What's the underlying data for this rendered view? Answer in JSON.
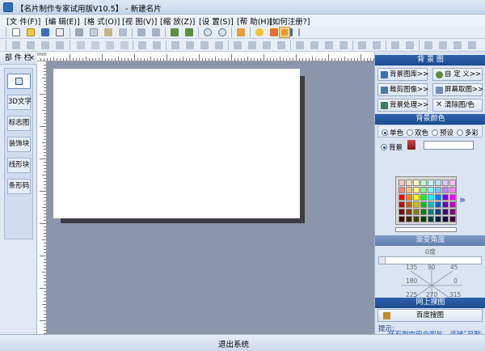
{
  "window": {
    "title": "【名片制作专家试用版V10.5】 - 新建名片"
  },
  "menu": [
    "[文 件(F)]",
    "[编 辑(E)]",
    "[格 式(O)]",
    "[视 图(V)]",
    "[缩 放(Z)]",
    "[设 置(S)]",
    "[帮 助(H)]",
    "[如何注册?]"
  ],
  "left_panel": {
    "header": "部 件 栏",
    "close": "×",
    "items": [
      "3D文字",
      "标志图",
      "装饰块",
      "线形块",
      "条形码"
    ]
  },
  "ruler": {
    "unit": "mm"
  },
  "right_panel": {
    "bg_header": "背 景 图",
    "bg_buttons": [
      "背景图库>>",
      "自 定 义>>",
      "裁剪图像>>",
      "屏幕取图>>",
      "背景处理>>",
      "清除图/色"
    ],
    "color_header": "背景颜色",
    "color_modes": [
      "单色",
      "双色",
      "预设",
      "多彩"
    ],
    "bg_label": "背景",
    "gradient_header": "渐变角度",
    "angle_value": "0度",
    "angle_labels": [
      "135",
      "90",
      "45",
      "180",
      "0",
      "225",
      "270",
      "315"
    ],
    "online_header": "网上搜图",
    "baidu_button": "百度搜图",
    "hint_label": "提示:",
    "hint_text": "在右图面中点图片，选择“复制"
  },
  "status": {
    "exit": "退出系统"
  },
  "colors": {
    "accent": "#1c4a8f",
    "canvas_bg": "#8b95ab",
    "palette": [
      [
        "#ffc0c0",
        "#ffe0c0",
        "#ffffc0",
        "#c0ffc0",
        "#c0ffff",
        "#c0e0ff",
        "#e0c0ff",
        "#ffc0ff"
      ],
      [
        "#ff8080",
        "#ffc080",
        "#ffff80",
        "#80ff80",
        "#80ffff",
        "#80c0ff",
        "#c080ff",
        "#ff80ff"
      ],
      [
        "#ff0000",
        "#ff8000",
        "#ffff00",
        "#00ff00",
        "#00ffff",
        "#0080ff",
        "#8000ff",
        "#ff00ff"
      ],
      [
        "#c00000",
        "#c06000",
        "#c0c000",
        "#00c000",
        "#00c0c0",
        "#0060c0",
        "#6000c0",
        "#c000c0"
      ],
      [
        "#800000",
        "#804000",
        "#808000",
        "#008000",
        "#008080",
        "#004080",
        "#400080",
        "#800080"
      ],
      [
        "#400000",
        "#402000",
        "#404000",
        "#004000",
        "#004040",
        "#002040",
        "#200040",
        "#400040"
      ]
    ]
  }
}
